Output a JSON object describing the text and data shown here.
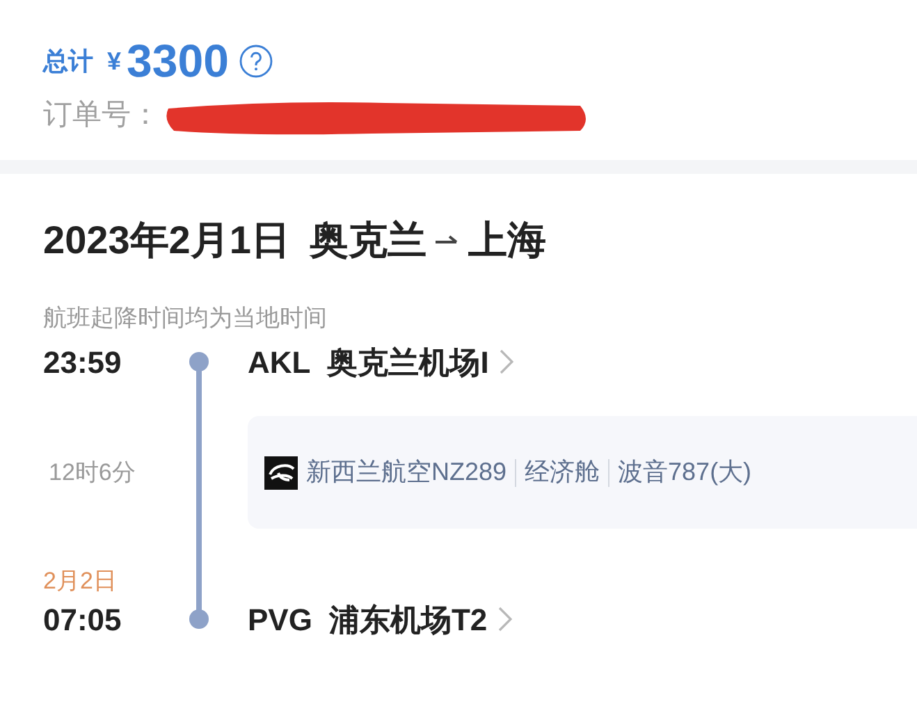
{
  "summary": {
    "total_label": "总计",
    "currency": "¥",
    "total": "3300",
    "order_label": "订单号："
  },
  "trip": {
    "date": "2023年2月1日",
    "from": "奥克兰",
    "to": "上海",
    "note": "航班起降时间均为当地时间",
    "departure": {
      "time": "23:59",
      "code": "AKL",
      "airport": "奥克兰机场I"
    },
    "duration": "12时6分",
    "flight": {
      "airline": "新西兰航空NZ289",
      "cabin": "经济舱",
      "aircraft": "波音787(大)"
    },
    "arrival": {
      "date": "2月2日",
      "time": "07:05",
      "code": "PVG",
      "airport": "浦东机场T2"
    }
  }
}
